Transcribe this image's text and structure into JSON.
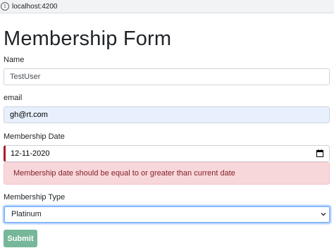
{
  "browser": {
    "url": "localhost:4200"
  },
  "page": {
    "title": "Membership Form"
  },
  "form": {
    "name": {
      "label": "Name",
      "value": "TestUser"
    },
    "email": {
      "label": "email",
      "value": "gh@rt.com"
    },
    "membership_date": {
      "label": "Membership Date",
      "value": "12-11-2020",
      "error": "Membership date should be equal to or greater than current date"
    },
    "membership_type": {
      "label": "Membership Type",
      "selected": "Platinum"
    },
    "submit_label": "Submit"
  },
  "colors": {
    "error_bg": "#f8d7da",
    "error_text": "#842029",
    "submit_bg": "#75b798",
    "focus_border": "#86b7fe",
    "autofill_bg": "#e8f0fe"
  }
}
